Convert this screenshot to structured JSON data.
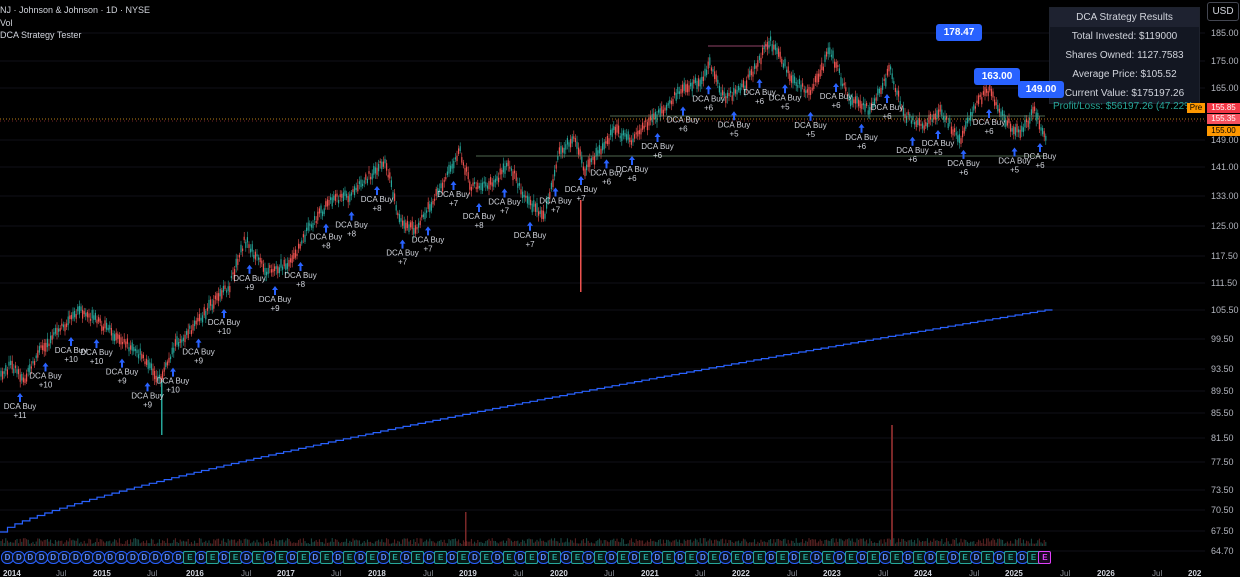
{
  "header": {
    "symbol_line": "NJ · Johnson & Johnson · 1D · NYSE",
    "vol_label": "Vol",
    "strategy_label": "DCA Strategy Tester"
  },
  "currency_button": "USD",
  "results_panel": {
    "title": "DCA Strategy Results",
    "total_invested": "Total Invested: $119000",
    "shares_owned": "Shares Owned: 1127.7583",
    "average_price": "Average Price: $105.52",
    "current_value": "Current Value: $175197.26",
    "profit_loss": "Profit/Loss: $56197.26 (47.22%"
  },
  "price_tags": [
    {
      "text": "155.85",
      "bg": "#f23645",
      "color": "#ffffff"
    },
    {
      "text": "155.35",
      "bg": "#f7525f",
      "color": "#ffffff"
    },
    {
      "text": "155.00",
      "bg": "#ff9800",
      "color": "#000000"
    }
  ],
  "pre_label": "Pre",
  "callouts": [
    "178.47",
    "163.00",
    "149.00"
  ],
  "y_axis_labels": [
    "185.00",
    "175.00",
    "165.00",
    "149.00",
    "141.00",
    "133.00",
    "125.00",
    "117.50",
    "111.50",
    "105.50",
    "99.50",
    "93.50",
    "89.50",
    "85.50",
    "81.50",
    "77.50",
    "73.50",
    "70.50",
    "67.50",
    "64.70"
  ],
  "x_axis_labels": [
    "2014",
    "Jul",
    "2015",
    "Jul",
    "2016",
    "Jul",
    "2017",
    "Jul",
    "2018",
    "Jul",
    "2019",
    "Jul",
    "2020",
    "Jul",
    "2021",
    "Jul",
    "2022",
    "Jul",
    "2023",
    "Jul",
    "2024",
    "Jul",
    "2025",
    "Jul",
    "2026",
    "Jul",
    "202"
  ],
  "dca_label": "DCA Buy",
  "dca_markers": [
    {
      "amount": "+11"
    },
    {
      "amount": "+10"
    },
    {
      "amount": "+10"
    },
    {
      "amount": "+10"
    },
    {
      "amount": "+9"
    },
    {
      "amount": "+9"
    },
    {
      "amount": "+10"
    },
    {
      "amount": "+9"
    },
    {
      "amount": "+10"
    },
    {
      "amount": "+9"
    },
    {
      "amount": "+9"
    },
    {
      "amount": "+8"
    },
    {
      "amount": "+8"
    },
    {
      "amount": "+8"
    },
    {
      "amount": "+8"
    },
    {
      "amount": "+7"
    },
    {
      "amount": "+7"
    },
    {
      "amount": "+7"
    },
    {
      "amount": "+8"
    },
    {
      "amount": "+7"
    },
    {
      "amount": "+7"
    },
    {
      "amount": "+7"
    },
    {
      "amount": "+7"
    },
    {
      "amount": "+6"
    },
    {
      "amount": "+6"
    },
    {
      "amount": "+6"
    },
    {
      "amount": "+6"
    },
    {
      "amount": "+6"
    },
    {
      "amount": "+5"
    },
    {
      "amount": "+6"
    },
    {
      "amount": "+5"
    },
    {
      "amount": "+5"
    },
    {
      "amount": "+6"
    },
    {
      "amount": "+6"
    },
    {
      "amount": "+6"
    },
    {
      "amount": "+6"
    },
    {
      "amount": "+5"
    },
    {
      "amount": "+6"
    },
    {
      "amount": "+6"
    },
    {
      "amount": "+5"
    },
    {
      "amount": "+6"
    }
  ],
  "event_markers": [
    "D",
    "D",
    "D",
    "D",
    "D",
    "D",
    "D",
    "D",
    "D",
    "D",
    "D",
    "D",
    "D",
    "D",
    "D",
    "D",
    "E",
    "D",
    "E",
    "D",
    "E",
    "D",
    "E",
    "D",
    "E",
    "D",
    "E",
    "D",
    "E",
    "D",
    "E",
    "D",
    "E",
    "D",
    "E",
    "D",
    "E",
    "D",
    "E",
    "D",
    "E",
    "D",
    "E",
    "D",
    "E",
    "D",
    "E",
    "D",
    "E",
    "D",
    "E",
    "D",
    "E",
    "D",
    "E",
    "D",
    "E",
    "D",
    "E",
    "D",
    "E",
    "D",
    "E",
    "D",
    "E",
    "D",
    "E",
    "D",
    "E",
    "D",
    "E",
    "D",
    "E",
    "D",
    "E",
    "D",
    "E",
    "D",
    "E",
    "D",
    "E",
    "D",
    "E",
    "D",
    "E",
    "D",
    "E",
    "D",
    "E",
    "D",
    "E",
    "E"
  ],
  "colors": {
    "up": "#26a69a",
    "down": "#ef5350",
    "cost_line": "#2962ff",
    "buy_arrow": "#2962ff",
    "price_line": "#f5a623",
    "panel_bg": "#131722"
  }
}
